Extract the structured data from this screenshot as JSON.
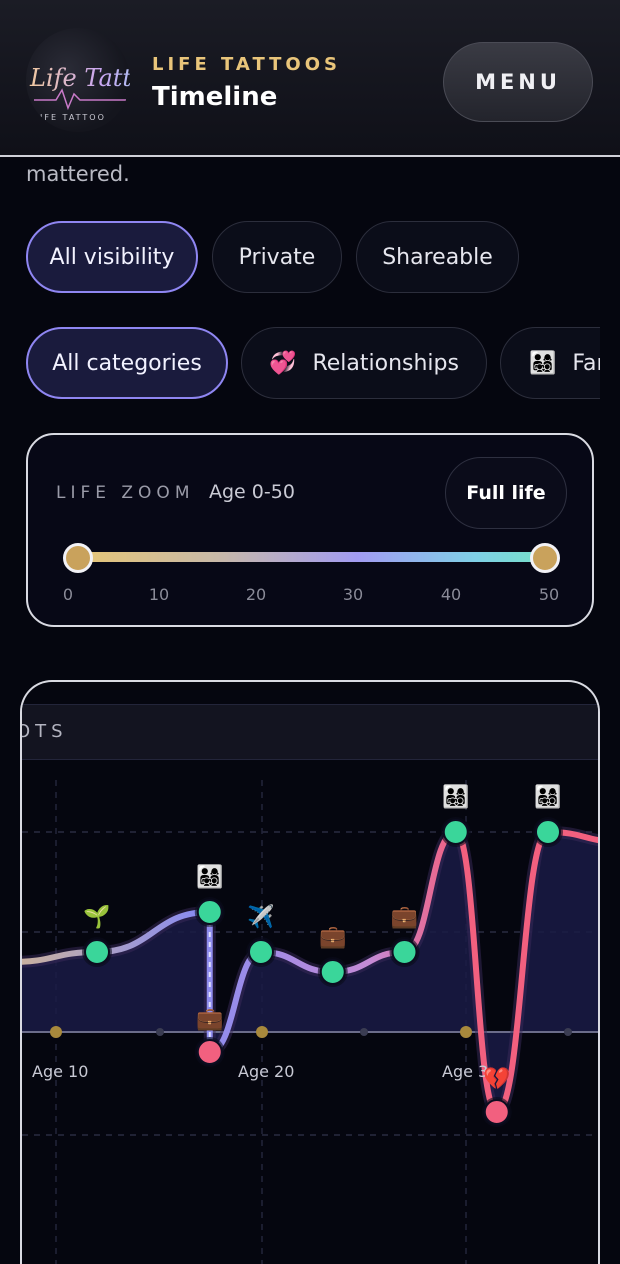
{
  "header": {
    "brand": "LIFE TATTOOS",
    "title": "Timeline",
    "menu_label": "MENU",
    "logo_text": "Life Tattoos",
    "logo_sub": "IFE TATTOO"
  },
  "intro_tail": "mattered.",
  "visibility_filters": [
    {
      "label": "All visibility",
      "active": true
    },
    {
      "label": "Private",
      "active": false
    },
    {
      "label": "Shareable",
      "active": false
    }
  ],
  "category_filters": [
    {
      "label": "All categories",
      "active": true,
      "icon": ""
    },
    {
      "label": "Relationships",
      "active": false,
      "icon": "💞"
    },
    {
      "label": "Family",
      "active": false,
      "icon": "👨‍👩‍👧‍👦"
    }
  ],
  "life_zoom": {
    "label": "LIFE ZOOM",
    "range_text": "Age 0-50",
    "full_life_label": "Full life",
    "range_min": 0,
    "range_max": 50,
    "selected": [
      0,
      50
    ],
    "ticks": [
      "0",
      "10",
      "20",
      "30",
      "40",
      "50"
    ],
    "track_colors": [
      "#e6c676",
      "#a29cf2",
      "#76e0c8"
    ]
  },
  "timeline": {
    "section_title_visible": "OTS",
    "age_labels": [
      "Age 10",
      "Age 20",
      "Age 3"
    ],
    "colors": {
      "positive": "#3ad69a",
      "negative": "#f2607f",
      "line_mid": "#c58bd6",
      "line_start": "#c9b1a0",
      "baseline": "#6b6c8a",
      "tick_dot": "#a8893c"
    },
    "events": [
      {
        "age": 12,
        "score": 0.8,
        "icon": "🌱",
        "icon_name": "seedling-icon"
      },
      {
        "age": 17.5,
        "score": 1.2,
        "icon": "👨‍👩‍👧‍👦",
        "icon_name": "family-icon"
      },
      {
        "age": 17.5,
        "score": -0.2,
        "icon": "💼",
        "icon_name": "briefcase-icon"
      },
      {
        "age": 20,
        "score": 0.8,
        "icon": "✈️",
        "icon_name": "airplane-icon"
      },
      {
        "age": 23.5,
        "score": 0.6,
        "icon": "💼",
        "icon_name": "briefcase-icon"
      },
      {
        "age": 27,
        "score": 0.8,
        "icon": "💼",
        "icon_name": "briefcase-icon"
      },
      {
        "age": 29.5,
        "score": 2.0,
        "icon": "👨‍👩‍👧‍👦",
        "icon_name": "family-icon"
      },
      {
        "age": 31.5,
        "score": -0.8,
        "icon": "💔",
        "icon_name": "broken-heart-icon"
      },
      {
        "age": 34,
        "score": 2.0,
        "icon": "👨‍👩‍👧‍👦",
        "icon_name": "family-icon"
      }
    ]
  }
}
